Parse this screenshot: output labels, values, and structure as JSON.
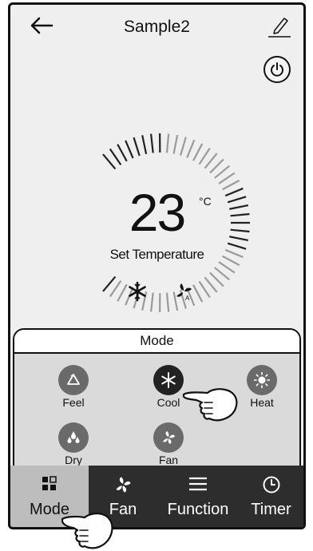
{
  "header": {
    "title": "Sample2",
    "back_icon": "arrow-left-icon",
    "edit_icon": "pencil-icon"
  },
  "power": {
    "icon": "power-icon"
  },
  "thermostat": {
    "temperature": "23",
    "unit": "°C",
    "label": "Set Temperature",
    "status_icons": [
      "snowflake-icon",
      "fan-auto-icon"
    ]
  },
  "mode_panel": {
    "title": "Mode",
    "options": [
      {
        "label": "Feel",
        "icon": "recycle-icon",
        "selected": false
      },
      {
        "label": "Cool",
        "icon": "snowflake-icon",
        "selected": true
      },
      {
        "label": "Heat",
        "icon": "sun-icon",
        "selected": false
      },
      {
        "label": "Dry",
        "icon": "droplets-icon",
        "selected": false
      },
      {
        "label": "Fan",
        "icon": "fan-icon",
        "selected": false
      }
    ]
  },
  "tabs": [
    {
      "label": "Mode",
      "icon": "mode-icon",
      "active": true
    },
    {
      "label": "Fan",
      "icon": "fan-icon",
      "active": false
    },
    {
      "label": "Function",
      "icon": "menu-icon",
      "active": false
    },
    {
      "label": "Timer",
      "icon": "clock-icon",
      "active": false
    }
  ],
  "colors": {
    "background": "#efefef",
    "tabbar": "#2d2d2d",
    "active_tab": "#bdbdbd",
    "panel": "#dadada"
  }
}
